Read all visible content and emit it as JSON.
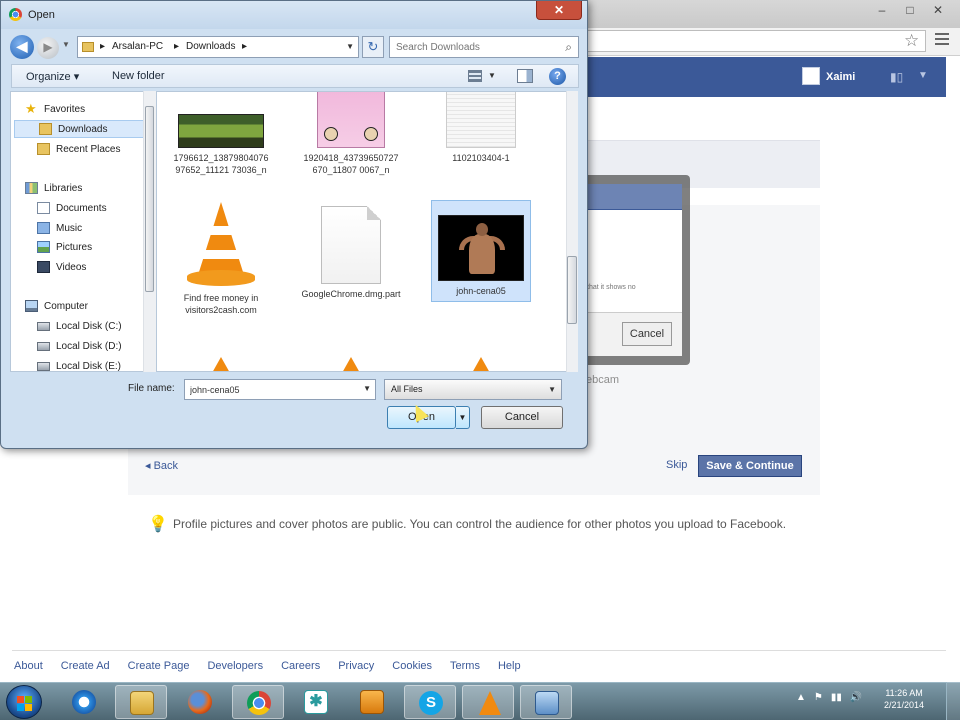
{
  "browser": {
    "window_controls": [
      "–",
      "□",
      "✕"
    ]
  },
  "facebook": {
    "user_name": "Xaimi",
    "sub_dialog_text": "that it shows no",
    "sub_dialog_cancel": "Cancel",
    "webcam_text": "ebcam",
    "back_link": "◂ Back",
    "skip_link": "Skip",
    "save_button": "Save & Continue",
    "info_text": "Profile pictures and cover photos are public. You can control the audience for other photos you upload to Facebook.",
    "footer_links": [
      "About",
      "Create Ad",
      "Create Page",
      "Developers",
      "Careers",
      "Privacy",
      "Cookies",
      "Terms",
      "Help"
    ]
  },
  "dialog": {
    "title": "Open",
    "close_label": "✕",
    "address_segments": [
      "Arsalan-PC",
      "Downloads"
    ],
    "search_placeholder": "Search Downloads",
    "toolbar": {
      "organize": "Organize ▾",
      "new_folder": "New folder"
    },
    "nav_items": [
      {
        "label": "Favorites",
        "icon": "star-icon"
      },
      {
        "label": "Downloads",
        "icon": "folder-icon"
      },
      {
        "label": "Recent Places",
        "icon": "folder-icon"
      },
      {
        "label": "Libraries",
        "icon": "library-icon"
      },
      {
        "label": "Documents",
        "icon": "document-icon"
      },
      {
        "label": "Music",
        "icon": "music-icon"
      },
      {
        "label": "Pictures",
        "icon": "pictures-icon"
      },
      {
        "label": "Videos",
        "icon": "video-icon"
      },
      {
        "label": "Computer",
        "icon": "computer-icon"
      },
      {
        "label": "Local Disk (C:)",
        "icon": "disk-icon"
      },
      {
        "label": "Local Disk (D:)",
        "icon": "disk-icon"
      },
      {
        "label": "Local Disk (E:)",
        "icon": "disk-icon"
      }
    ],
    "files": [
      {
        "name": "1796612_13879804076 97652_11121 73036_n"
      },
      {
        "name": "1920418_43739650727670_11807 0067_n"
      },
      {
        "name": "1102103404-1"
      },
      {
        "name": "Find free money in visitors2cash.com"
      },
      {
        "name": "GoogleChrome.dmg.part"
      },
      {
        "name": "john-cena05"
      }
    ],
    "file_name_label": "File name:",
    "file_name_value": "john-cena05",
    "filter_value": "All Files",
    "open_button": "Open",
    "cancel_button": "Cancel"
  },
  "taskbar": {
    "tray_icons": [
      "▲",
      "⚑",
      "▮▮",
      "🔊"
    ],
    "time": "11:26 AM",
    "date": "2/21/2014"
  }
}
